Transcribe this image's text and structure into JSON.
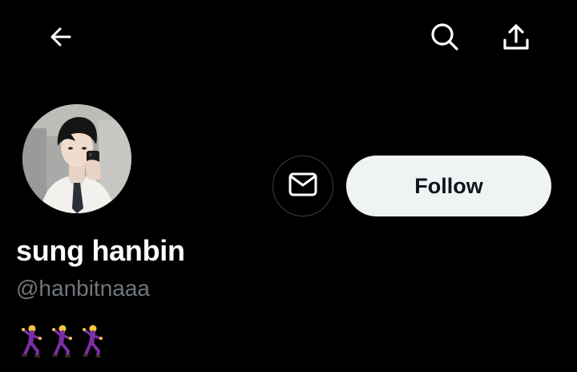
{
  "header": {
    "back_icon": "arrow-left-icon",
    "search_icon": "search-icon",
    "share_icon": "share-upload-icon"
  },
  "profile": {
    "avatar": "profile-photo",
    "display_name": "sung hanbin",
    "handle": "@hanbitnaaa",
    "bio_emojis": [
      "man-dancing-emoji",
      "man-dancing-emoji",
      "man-dancing-emoji"
    ]
  },
  "actions": {
    "message_icon": "envelope-icon",
    "follow_label": "Follow"
  },
  "colors": {
    "background": "#000000",
    "text_primary": "#ffffff",
    "text_secondary": "#71767b",
    "follow_bg": "#eff3f4",
    "follow_text": "#0f1419",
    "border": "#3a3f44"
  }
}
